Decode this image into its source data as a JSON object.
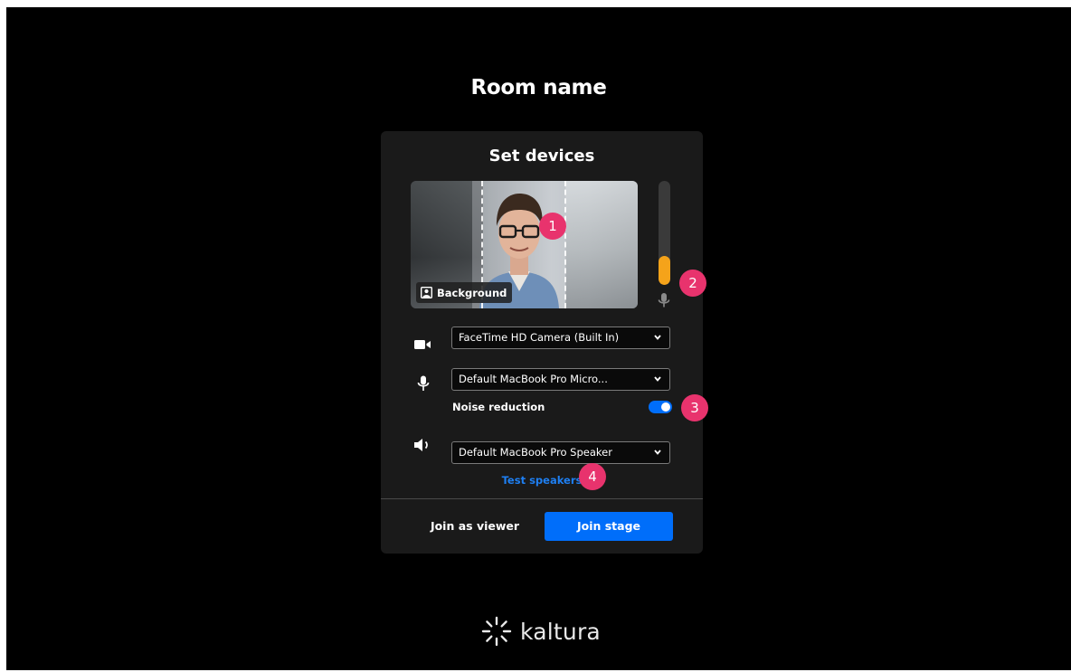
{
  "room": {
    "title": "Room name"
  },
  "card": {
    "title": "Set devices",
    "background_button": "Background",
    "mic_level_fraction": 0.28,
    "camera": {
      "selected": "FaceTime HD Camera (Built In)"
    },
    "microphone": {
      "selected": "Default MacBook Pro Micro..."
    },
    "noise_reduction": {
      "label": "Noise reduction",
      "enabled": true
    },
    "speaker": {
      "selected": "Default MacBook Pro Speaker"
    },
    "test_speakers": "Test speakers",
    "join_viewer": "Join as viewer",
    "join_stage": "Join stage"
  },
  "markers": [
    "1",
    "2",
    "3",
    "4"
  ],
  "brand": {
    "name": "kaltura"
  },
  "colors": {
    "background": "#000000",
    "card": "#1a1a1a",
    "accent_blue": "#006efa",
    "link_blue": "#1e7ff2",
    "level_orange": "#f5a31a",
    "marker_pink": "#e8336d"
  },
  "icons": [
    "video-camera-icon",
    "microphone-icon",
    "speaker-icon",
    "background-icon",
    "chevron-down-icon",
    "kaltura-logo-icon"
  ]
}
